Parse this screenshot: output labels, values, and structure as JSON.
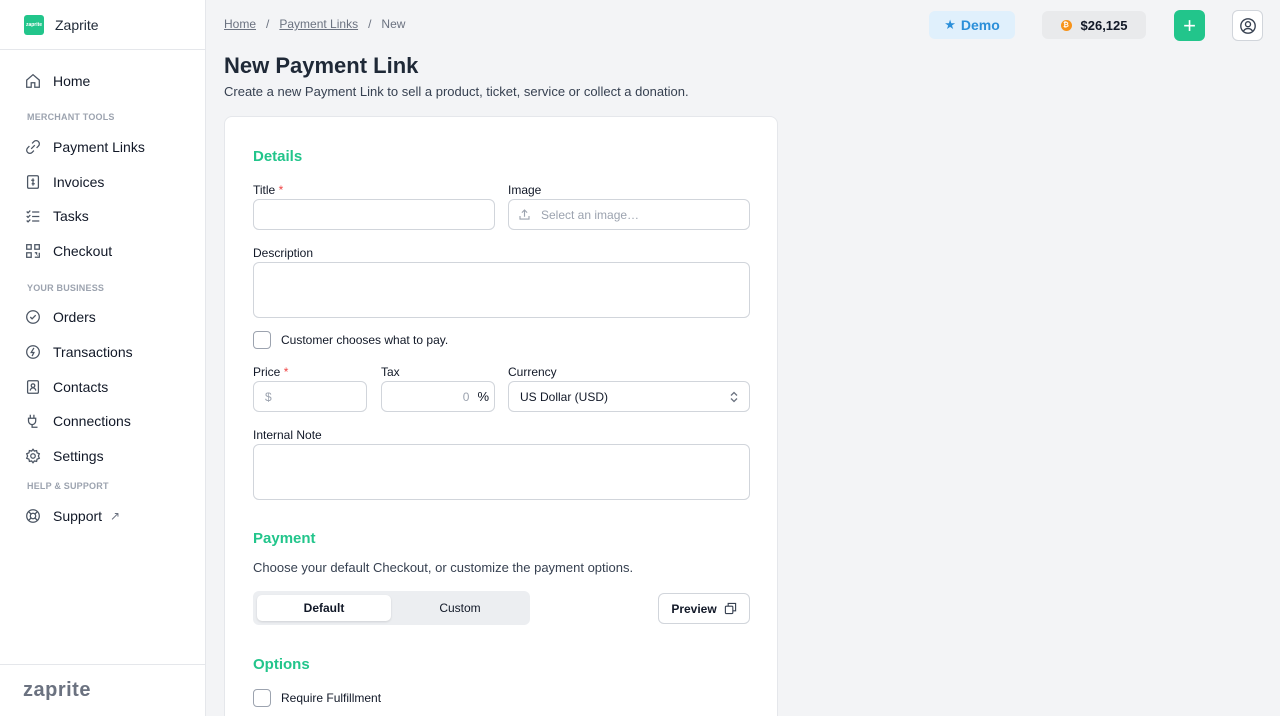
{
  "brand": {
    "logo_text": "zaprite",
    "name": "Zaprite",
    "footer_wordmark": "zaprite"
  },
  "sidebar": {
    "home": "Home",
    "sections": [
      "MERCHANT TOOLS",
      "YOUR BUSINESS",
      "HELP & SUPPORT"
    ],
    "merchant_tools": [
      "Payment Links",
      "Invoices",
      "Tasks",
      "Checkout"
    ],
    "your_business": [
      "Orders",
      "Transactions",
      "Contacts",
      "Connections",
      "Settings"
    ],
    "support": "Support",
    "support_ext": "↗"
  },
  "breadcrumb": {
    "home": "Home",
    "sep": "/",
    "payment_links": "Payment Links",
    "current": "New"
  },
  "topbar": {
    "demo_label": "Demo",
    "balance": "$26,125",
    "add_label": "+",
    "btc_symbol": "₿"
  },
  "page": {
    "title": "New Payment Link",
    "subtitle": "Create a new Payment Link to sell a product, ticket, service or collect a donation."
  },
  "form": {
    "details_title": "Details",
    "title_label": "Title",
    "required_mark": "*",
    "title_value": "",
    "image_label": "Image",
    "image_placeholder": "Select an image…",
    "description_label": "Description",
    "description_value": "",
    "customer_chooses_label": "Customer chooses what to pay.",
    "customer_chooses_checked": false,
    "price_label": "Price",
    "price_prefix": "$",
    "price_value": "",
    "tax_label": "Tax",
    "tax_value": "0",
    "tax_suffix": "%",
    "currency_label": "Currency",
    "currency_value": "US Dollar (USD)",
    "internal_note_label": "Internal Note",
    "internal_note_value": "",
    "payment_title": "Payment",
    "payment_desc": "Choose your default Checkout, or customize the payment options.",
    "payment_options": [
      "Default",
      "Custom"
    ],
    "payment_selected": "Default",
    "preview_label": "Preview",
    "options_title": "Options",
    "require_fulfillment_label": "Require Fulfillment",
    "require_fulfillment_checked": false
  },
  "colors": {
    "accent": "#22c58b",
    "demo": "#2b8fd9",
    "btc": "#f7931a",
    "required": "#ef4444"
  }
}
